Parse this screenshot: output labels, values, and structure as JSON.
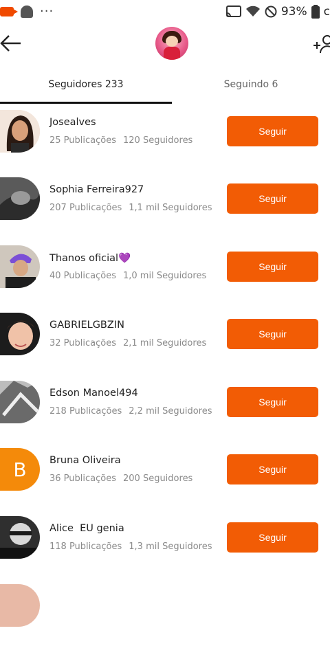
{
  "status_bar": {
    "dots": "···",
    "battery_percent": "93%"
  },
  "header": {
    "back_icon": "arrow-left-icon",
    "add_user_icon": "add-user-icon"
  },
  "tabs": [
    {
      "label": "Seguidores 233",
      "active": true
    },
    {
      "label": "Seguindo 6",
      "active": false
    }
  ],
  "colors": {
    "accent": "#f25c05",
    "tab_underline": "#111111"
  },
  "users": [
    {
      "name": "Josealves",
      "posts": "25 Publicações",
      "followers": "120 Seguidores",
      "button": "Seguir",
      "avatar_color": "#f1d3c1"
    },
    {
      "name": "Sophia Ferreira927",
      "posts": "207 Publicações",
      "followers": "1,1 mil Seguidores",
      "button": "Seguir",
      "avatar_color": "#4a4a4a"
    },
    {
      "name": "Thanos oficial",
      "name_suffix": "💜",
      "posts": "40 Publicações",
      "followers": "1,0 mil Seguidores",
      "button": "Seguir",
      "avatar_color": "#6b5aa8"
    },
    {
      "name": "GABRIELGBZIN",
      "posts": "32 Publicações",
      "followers": "2,1 mil Seguidores",
      "button": "Seguir",
      "avatar_color": "#2b2b2b"
    },
    {
      "name": "Edson Manoel494",
      "posts": "218 Publicações",
      "followers": "2,2 mil Seguidores",
      "button": "Seguir",
      "avatar_color": "#8d8d8d"
    },
    {
      "name": "Bruna Oliveira",
      "posts": "36 Publicações",
      "followers": "200 Seguidores",
      "button": "Seguir",
      "avatar_letter": "B",
      "avatar_color": "#f48a0a"
    },
    {
      "name": "Alice  EU genia",
      "posts": "118 Publicações",
      "followers": "1,3 mil Seguidores",
      "button": "Seguir",
      "avatar_color": "#3a3a3a"
    }
  ]
}
